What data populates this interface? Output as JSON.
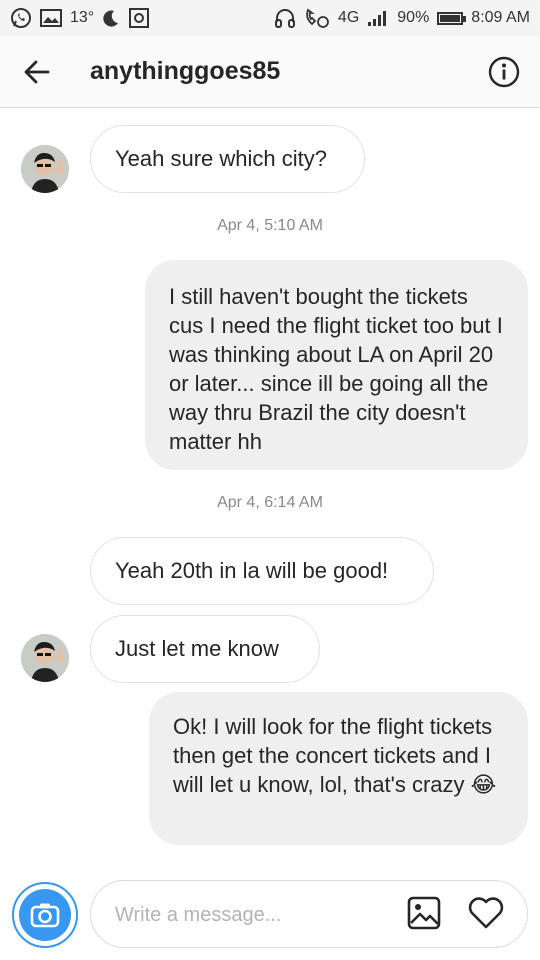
{
  "status_bar": {
    "temperature": "13°",
    "network": "4G",
    "battery": "90%",
    "time": "8:09 AM",
    "icons": [
      "whatsapp-icon",
      "gallery-icon",
      "moon-icon",
      "voice-assistant-icon",
      "headphones-icon",
      "wifi-call-icon",
      "signal-icon",
      "battery-icon"
    ]
  },
  "header": {
    "username": "anythinggoes85",
    "back_icon": "arrow-left-icon",
    "info_icon": "info-icon"
  },
  "messages": [
    {
      "type": "incoming",
      "text": "Yeah sure which city?",
      "avatar": true
    },
    {
      "type": "timestamp",
      "text": "Apr 4, 5:10 AM"
    },
    {
      "type": "outgoing",
      "text": "I still haven't bought the tickets cus I need the flight ticket too but I was thinking about LA on April 20 or later... since ill be going all the way thru Brazil the city doesn't matter hh"
    },
    {
      "type": "timestamp",
      "text": "Apr 4, 6:14 AM"
    },
    {
      "type": "incoming",
      "text": "Yeah 20th in la will be good!",
      "avatar": false
    },
    {
      "type": "incoming",
      "text": "Just let me know",
      "avatar": true
    },
    {
      "type": "outgoing",
      "text": "Ok! I will look for the flight tickets then get the concert tickets and I will let u know, lol, that's crazy",
      "emoji": "😂"
    }
  ],
  "composer": {
    "placeholder": "Write a message...",
    "value": "",
    "camera_icon": "camera-icon",
    "gallery_icon": "image-icon",
    "like_icon": "heart-icon"
  },
  "colors": {
    "accent": "#3897f0",
    "outgoing_bubble": "#efefef",
    "incoming_border": "#e2e2e2",
    "timestamp": "#8a8a8a"
  }
}
